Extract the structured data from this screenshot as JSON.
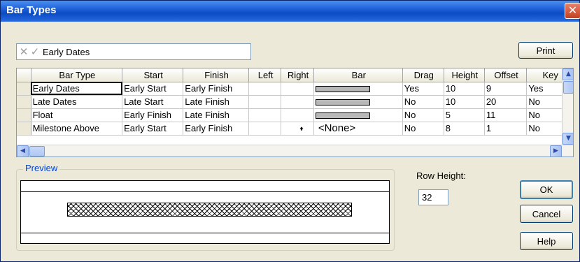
{
  "window": {
    "title": "Bar Types",
    "close_glyph": "✕"
  },
  "edit_bar": {
    "cancel_glyph": "✕",
    "accept_glyph": "✓",
    "value": "Early Dates"
  },
  "buttons": {
    "print": "Print",
    "ok": "OK",
    "cancel": "Cancel",
    "help": "Help"
  },
  "table": {
    "columns": [
      "Bar Type",
      "Start",
      "Finish",
      "Left",
      "Right",
      "Bar",
      "Drag",
      "Height",
      "Offset",
      "Key"
    ],
    "rows": [
      {
        "bar_type": "Early Dates",
        "start": "Early Start",
        "finish": "Early Finish",
        "left": "",
        "right": "",
        "bar": "swatch",
        "drag": "Yes",
        "height": "10",
        "offset": "9",
        "key": "Yes"
      },
      {
        "bar_type": "Late Dates",
        "start": "Late Start",
        "finish": "Late Finish",
        "left": "",
        "right": "",
        "bar": "swatch",
        "drag": "No",
        "height": "10",
        "offset": "20",
        "key": "No"
      },
      {
        "bar_type": "Float",
        "start": "Early Finish",
        "finish": "Late Finish",
        "left": "",
        "right": "",
        "bar": "swatch",
        "drag": "No",
        "height": "5",
        "offset": "11",
        "key": "No"
      },
      {
        "bar_type": "Milestone Above",
        "start": "Early Start",
        "finish": "Early Finish",
        "left": "",
        "right": "up-arrow-icon",
        "bar": "<None>",
        "drag": "No",
        "height": "8",
        "offset": "1",
        "key": "No"
      }
    ],
    "bar_swatch_color": "#b8b8b8"
  },
  "preview": {
    "label": "Preview",
    "bar_pattern": "crosshatch"
  },
  "row_height": {
    "label": "Row Height:",
    "value": "32"
  },
  "colors": {
    "titlebar": "#0a4cc4",
    "dialog_bg": "#ece9d8",
    "group_label": "#0046d5",
    "close_button": "#c4401f"
  }
}
